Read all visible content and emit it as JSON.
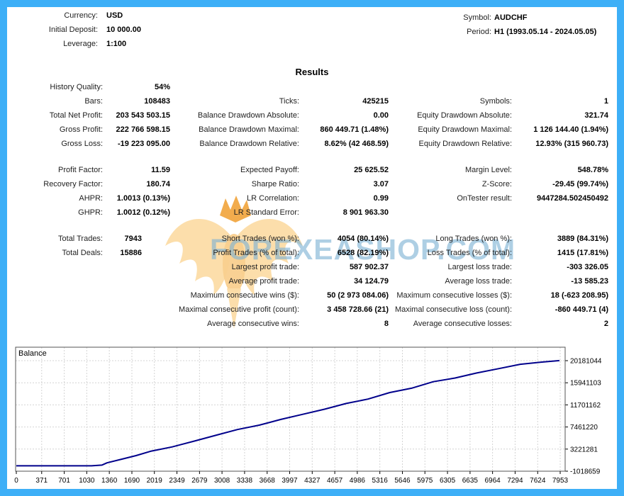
{
  "frame": {
    "border_color": "#3daff7"
  },
  "header": {
    "left": [
      {
        "label": "Currency:",
        "value": "USD"
      },
      {
        "label": "Initial Deposit:",
        "value": "10 000.00"
      },
      {
        "label": "Leverage:",
        "value": "1:100"
      }
    ],
    "right": [
      {
        "label": "Symbol:",
        "value": "AUDCHF"
      },
      {
        "label": "Period:",
        "value": "H1 (1993.05.14 - 2024.05.05)"
      }
    ]
  },
  "title": "Results",
  "stats": {
    "col1_a": [
      {
        "label": "History Quality:",
        "value": "54%"
      },
      {
        "label": "Bars:",
        "value": "108483"
      },
      {
        "label": "Total Net Profit:",
        "value": "203 543 503.15"
      },
      {
        "label": "Gross Profit:",
        "value": "222 766 598.15"
      },
      {
        "label": "Gross Loss:",
        "value": "-19 223 095.00"
      }
    ],
    "col2_a": [
      {
        "label": "Ticks:",
        "value": "425215"
      },
      {
        "label": "Balance Drawdown Absolute:",
        "value": "0.00"
      },
      {
        "label": "Balance Drawdown Maximal:",
        "value": "860 449.71 (1.48%)"
      },
      {
        "label": "Balance Drawdown Relative:",
        "value": "8.62% (42 468.59)"
      }
    ],
    "col3_a": [
      {
        "label": "Symbols:",
        "value": "1"
      },
      {
        "label": "Equity Drawdown Absolute:",
        "value": "321.74"
      },
      {
        "label": "Equity Drawdown Maximal:",
        "value": "1 126 144.40 (1.94%)"
      },
      {
        "label": "Equity Drawdown Relative:",
        "value": "12.93% (315 960.73)"
      }
    ],
    "col1_b": [
      {
        "label": "Profit Factor:",
        "value": "11.59"
      },
      {
        "label": "Recovery Factor:",
        "value": "180.74"
      },
      {
        "label": "AHPR:",
        "value": "1.0013 (0.13%)"
      },
      {
        "label": "GHPR:",
        "value": "1.0012 (0.12%)"
      }
    ],
    "col2_b": [
      {
        "label": "Expected Payoff:",
        "value": "25 625.52"
      },
      {
        "label": "Sharpe Ratio:",
        "value": "3.07"
      },
      {
        "label": "LR Correlation:",
        "value": "0.99"
      },
      {
        "label": "LR Standard Error:",
        "value": "8 901 963.30"
      }
    ],
    "col3_b": [
      {
        "label": "Margin Level:",
        "value": "548.78%"
      },
      {
        "label": "Z-Score:",
        "value": "-29.45 (99.74%)"
      },
      {
        "label": "OnTester result:",
        "value": "9447284.502450492"
      }
    ],
    "col1_c": [
      {
        "label": "Total Trades:",
        "value": "7943"
      },
      {
        "label": "Total Deals:",
        "value": "15886"
      }
    ],
    "col2_c": [
      {
        "label": "Short Trades (won %):",
        "value": "4054 (80.14%)"
      },
      {
        "label": "Profit Trades (% of total):",
        "value": "6528 (82.19%)"
      },
      {
        "label": "Largest profit trade:",
        "value": "587 902.37"
      },
      {
        "label": "Average profit trade:",
        "value": "34 124.79"
      },
      {
        "label": "Maximum consecutive wins ($):",
        "value": "50 (2 973 084.06)"
      },
      {
        "label": "Maximal consecutive profit (count):",
        "value": "3 458 728.66 (21)"
      },
      {
        "label": "Average consecutive wins:",
        "value": "8"
      }
    ],
    "col3_c": [
      {
        "label": "Long Trades (won %):",
        "value": "3889 (84.31%)"
      },
      {
        "label": "Loss Trades (% of total):",
        "value": "1415 (17.81%)"
      },
      {
        "label": "Largest loss trade:",
        "value": "-303 326.05"
      },
      {
        "label": "Average loss trade:",
        "value": "-13 585.23"
      },
      {
        "label": "Maximum consecutive losses ($):",
        "value": "18 (-623 208.95)"
      },
      {
        "label": "Maximal consecutive loss (count):",
        "value": "-860 449.71 (4)"
      },
      {
        "label": "Average consecutive losses:",
        "value": "2"
      }
    ]
  },
  "watermark": {
    "text": "FOREXEASHOP.COM",
    "text_color": "rgba(125,178,211,0.62)",
    "wing_color": "#fcdca6",
    "body_color": "#f9cf8e",
    "crown_color": "#f1a33a"
  },
  "chart_data": {
    "type": "line",
    "title": "Balance",
    "line_color": "#00008b",
    "grid_color": "#d4d4d4",
    "axis_color": "#555555",
    "x_ticks": [
      0,
      371,
      701,
      1030,
      1360,
      1690,
      2019,
      2349,
      2679,
      3008,
      3338,
      3668,
      3997,
      4327,
      4657,
      4986,
      5316,
      5646,
      5975,
      6305,
      6635,
      6964,
      7294,
      7624,
      7953
    ],
    "y_tick_labels": [
      "20181044",
      "15941103",
      "11701162",
      "7461220",
      "3221281",
      "-1018659"
    ],
    "y_top": 20181044,
    "y_bottom": -1018659,
    "legend_position": "top-left",
    "grid": true,
    "series": [
      {
        "name": "Balance",
        "points": [
          [
            0,
            10000
          ],
          [
            600,
            10000
          ],
          [
            1100,
            15000
          ],
          [
            1250,
            150000
          ],
          [
            1326,
            580000
          ],
          [
            1538,
            1275000
          ],
          [
            1750,
            1970000
          ],
          [
            1962,
            2804000
          ],
          [
            2280,
            3638000
          ],
          [
            2598,
            4750000
          ],
          [
            2916,
            5862000
          ],
          [
            3234,
            6975000
          ],
          [
            3552,
            7809000
          ],
          [
            3870,
            8921000
          ],
          [
            4189,
            9894000
          ],
          [
            4507,
            10867000
          ],
          [
            4825,
            11979000
          ],
          [
            5143,
            12813000
          ],
          [
            5461,
            14064000
          ],
          [
            5779,
            14898000
          ],
          [
            6097,
            16150000
          ],
          [
            6415,
            16845000
          ],
          [
            6733,
            17818000
          ],
          [
            7051,
            18652000
          ],
          [
            7369,
            19486000
          ],
          [
            7687,
            19903000
          ],
          [
            7943,
            20191000
          ]
        ]
      }
    ]
  }
}
